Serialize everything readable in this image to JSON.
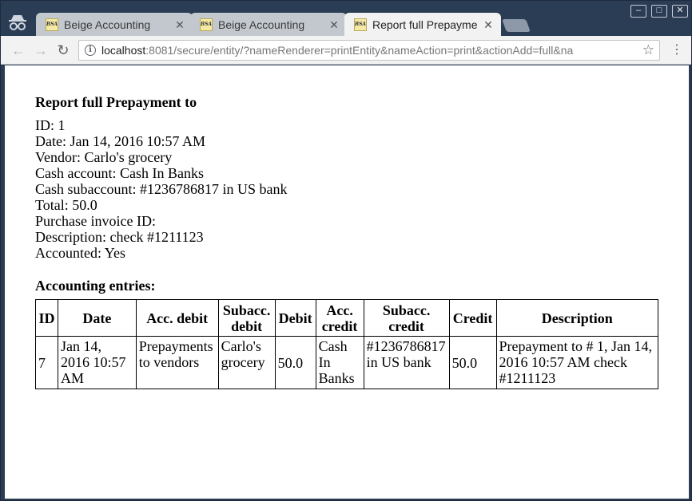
{
  "browser": {
    "tabs": [
      {
        "favicon": "BSA",
        "title": "Beige Accounting",
        "close": "✕"
      },
      {
        "favicon": "BSA",
        "title": "Beige Accounting",
        "close": "✕"
      },
      {
        "favicon": "BSA",
        "title": "Report full Prepayme",
        "close": "✕"
      }
    ],
    "window_controls": {
      "minimize": "–",
      "maximize": "□",
      "close": "✕"
    },
    "toolbar": {
      "back": "←",
      "forward": "→",
      "reload": "↻",
      "menu": "⋮"
    },
    "address": {
      "host": "localhost",
      "rest": ":8081/secure/entity/?nameRenderer=printEntity&nameAction=print&actionAdd=full&na",
      "info_glyph": "i",
      "star_glyph": "☆"
    }
  },
  "report": {
    "title": "Report full Prepayment to",
    "fields": [
      "ID: 1",
      "Date: Jan 14, 2016 10:57 AM",
      "Vendor: Carlo's grocery",
      "Cash account: Cash In Banks",
      "Cash subaccount: #1236786817 in US bank",
      "Total: 50.0",
      "Purchase invoice ID:",
      "Description: check #1211123",
      "Accounted: Yes"
    ],
    "entries_heading": "Accounting entries:",
    "table": {
      "headers": [
        "ID",
        "Date",
        "Acc. debit",
        "Subacc. debit",
        "Debit",
        "Acc. credit",
        "Subacc. credit",
        "Credit",
        "Description"
      ],
      "rows": [
        [
          "7",
          "Jan 14, 2016 10:57 AM",
          "Prepayments to vendors",
          "Carlo's grocery",
          "50.0",
          "Cash In Banks",
          "#1236786817 in US bank",
          "50.0",
          "Prepayment to # 1, Jan 14, 2016 10:57 AM check #1211123"
        ]
      ]
    }
  }
}
